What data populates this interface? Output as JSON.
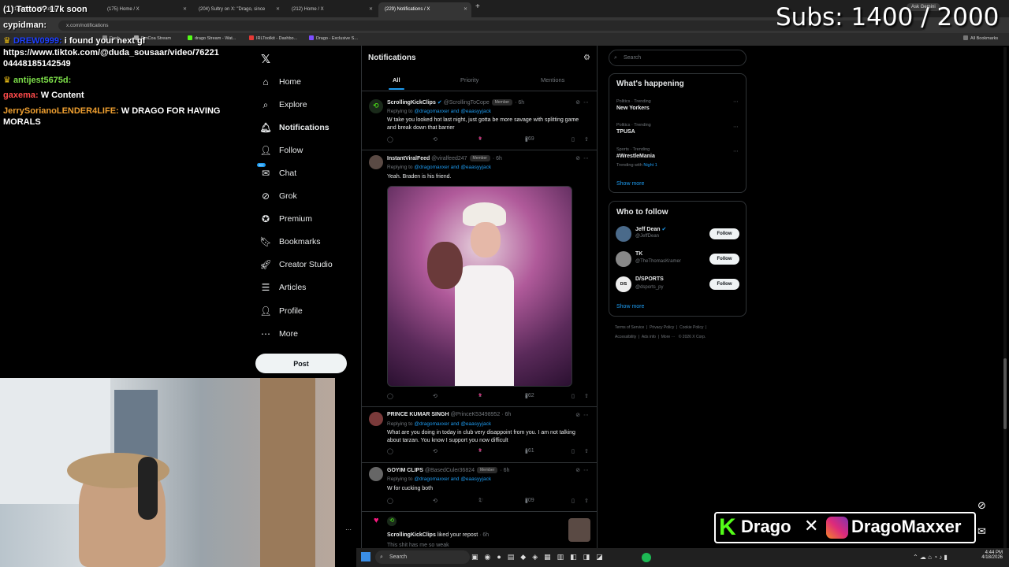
{
  "browser": {
    "tabs": [
      {
        "label": "(1) Tattoo? 17k soon"
      },
      {
        "label": "(175) Home / X"
      },
      {
        "label": "(204) Sultry on X: \"Drago, since"
      },
      {
        "label": "(212) Home / X"
      },
      {
        "label": "(229) Notifications / X"
      }
    ],
    "url": "x.com/notifications",
    "ask_gemini": "Ask Gemini",
    "bookmarks": [
      "Dash",
      "ProCoa Stream",
      "drago Stream - Wat...",
      "IRLToolkit - Dashbo...",
      "Drago - Exclusive S..."
    ],
    "all_bookmarks": "All Bookmarks"
  },
  "nav": {
    "items": [
      {
        "label": "Home",
        "icon": "home-icon"
      },
      {
        "label": "Explore",
        "icon": "search-icon"
      },
      {
        "label": "Notifications",
        "icon": "bell-icon"
      },
      {
        "label": "Follow",
        "icon": "person-plus-icon"
      },
      {
        "label": "Chat",
        "icon": "chat-icon"
      },
      {
        "label": "Grok",
        "icon": "grok-icon"
      },
      {
        "label": "Premium",
        "icon": "premium-icon"
      },
      {
        "label": "Bookmarks",
        "icon": "bookmark-icon"
      },
      {
        "label": "Creator Studio",
        "icon": "rocket-icon"
      },
      {
        "label": "Articles",
        "icon": "article-icon"
      },
      {
        "label": "Profile",
        "icon": "profile-icon"
      },
      {
        "label": "More",
        "icon": "more-icon"
      }
    ],
    "post_label": "Post",
    "chat_badge": "20+"
  },
  "feed": {
    "title": "Notifications",
    "tabs": [
      "All",
      "Priority",
      "Mentions"
    ],
    "tweets": [
      {
        "name": "ScrollingKickClips",
        "handle": "@ScrollingToCope",
        "badge": "Member",
        "time": "· 6h",
        "reply_to": "@dragomaxxer and @eaasyyjack",
        "text": "W take you looked hot last night, just gotta be more savage with splitting game and break down that barrier",
        "likes": "1",
        "views": "269"
      },
      {
        "name": "InstantViralFeed",
        "handle": "@viralfeed247",
        "badge": "Member",
        "time": "· 6h",
        "reply_to": "@dragomaxxer and @eaasyyjack",
        "text": "Yeah. Braden is his friend.",
        "likes": "1",
        "views": "262"
      },
      {
        "name": "PRINCE KUMAR SINGH",
        "handle": "@PrinceK53498952",
        "badge": "",
        "time": "· 6h",
        "reply_to": "@dragomaxxer and @eaasyyjack",
        "text": "What are you doing in today in club very disappoint from you. I am not talking about tarzan. You know I support you now difficult",
        "likes": "1",
        "views": "161"
      },
      {
        "name": "GOYIM CLIPS",
        "handle": "@BasedCuler36824",
        "badge": "Member",
        "time": "· 6h",
        "reply_to": "@dragomaxxer and @eaasyyjack",
        "text": "W for cucking both",
        "likes": "1",
        "views": "209"
      }
    ],
    "repost_notice": {
      "name": "ScrollingKickClips",
      "text": "liked your repost",
      "time": "· 6h",
      "quote": "This shit has me so weak"
    },
    "replying_to_label": "Replying to",
    "and_word": "and"
  },
  "right": {
    "search_placeholder": "Search",
    "happening_title": "What's happening",
    "trends": [
      {
        "meta": "Politics · Trending",
        "name": "New Yorkers",
        "sub": ""
      },
      {
        "meta": "Politics · Trending",
        "name": "TPUSA",
        "sub": ""
      },
      {
        "meta": "Sports · Trending",
        "name": "#WrestleMania",
        "sub_prefix": "Trending with",
        "sub_link": "Night 1"
      }
    ],
    "show_more": "Show more",
    "who_title": "Who to follow",
    "who": [
      {
        "name": "Jeff Dean",
        "handle": "@JeffDean"
      },
      {
        "name": "TK",
        "handle": "@TheThomasKramer"
      },
      {
        "name": "D/SPORTS",
        "handle": "@dsports_py"
      }
    ],
    "follow_label": "Follow",
    "footer": [
      "Terms of Service",
      "Privacy Policy",
      "Cookie Policy",
      "Accessibility",
      "Ads info",
      "More ···",
      "© 2026 X Corp."
    ]
  },
  "overlay": {
    "subs": "Subs: 1400 / 2000",
    "chat": [
      {
        "user": "cypidman:",
        "text": "",
        "color": "#ffffff"
      },
      {
        "user": "DREW0999:",
        "text": "i found your next gf",
        "color": "#1e40ff"
      },
      {
        "user": "",
        "text": "https://www.tiktok.com/@duda_sousaar/video/76221",
        "color": "#ffffff"
      },
      {
        "user": "",
        "text": "04448185142549",
        "color": "#ffffff"
      },
      {
        "user": "antijest5675d:",
        "text": "",
        "color": "#7ee04a"
      },
      {
        "user": "gaxema:",
        "text": "W Content",
        "color": "#ff4b4b"
      },
      {
        "user": "JerrySorianoLENDER4LIFE:",
        "text": "W DRAGO FOR HAVING",
        "color": "#f0a030"
      },
      {
        "user": "",
        "text": "MORALS",
        "color": "#ffffff"
      }
    ],
    "brand_left": "Drago",
    "brand_right": "DragoMaxxer"
  },
  "taskbar": {
    "search": "Search",
    "time": "4:44 PM",
    "date": "4/18/2026"
  }
}
